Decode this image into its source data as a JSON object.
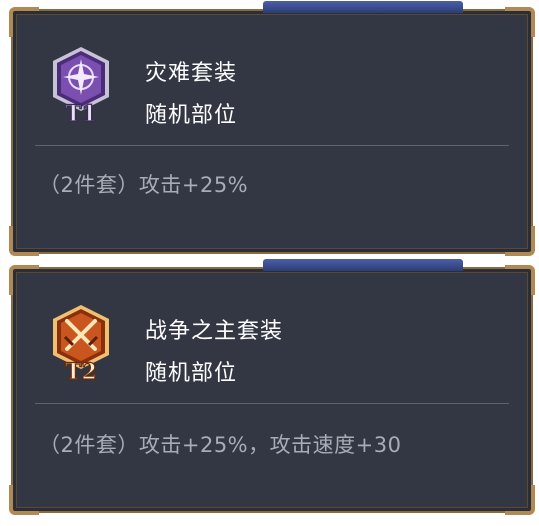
{
  "cards": [
    {
      "tier_label": "T1",
      "set_name": "灾难套装",
      "slot_text": "随机部位",
      "effect_text": "（2件套）攻击+25%",
      "colors": {
        "badge_primary": "#7a4fb0",
        "badge_dark": "#4a2c78",
        "badge_border": "#c8c2d6"
      },
      "icon": "purple-star-emblem-icon"
    },
    {
      "tier_label": "T2",
      "set_name": "战争之主套装",
      "slot_text": "随机部位",
      "effect_text": "（2件套）攻击+25%，攻击速度+30",
      "colors": {
        "badge_primary": "#c8561e",
        "badge_dark": "#8a2f0e",
        "badge_border": "#f0c070"
      },
      "icon": "crossed-swords-emblem-icon"
    }
  ]
}
